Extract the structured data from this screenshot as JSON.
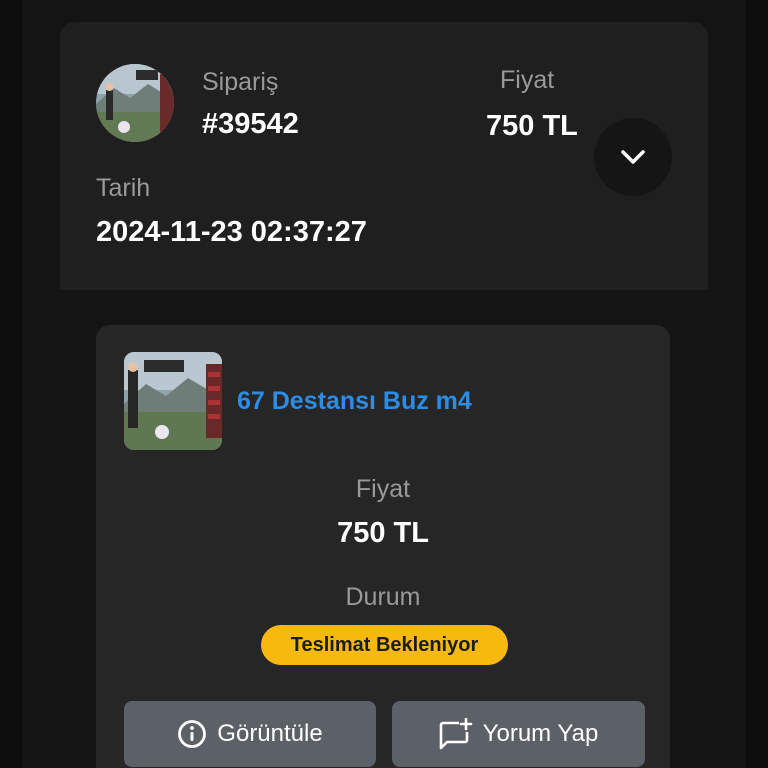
{
  "order": {
    "order_label": "Sipariş",
    "order_number": "#39542",
    "price_label": "Fiyat",
    "price_value": "750 TL",
    "date_label": "Tarih",
    "date_value": "2024-11-23 02:37:27",
    "expand_icon": "chevron-down-icon"
  },
  "item": {
    "name": "67 Destansı Buz m4",
    "price_label": "Fiyat",
    "price_value": "750 TL",
    "status_label": "Durum",
    "status_value": "Teslimat Bekleniyor",
    "status_color": "#f8b90f",
    "name_color": "#2d8ce6"
  },
  "actions": {
    "view_label": "Görüntüle",
    "view_icon": "info-icon",
    "comment_label": "Yorum Yap",
    "comment_icon": "add-comment-icon"
  }
}
